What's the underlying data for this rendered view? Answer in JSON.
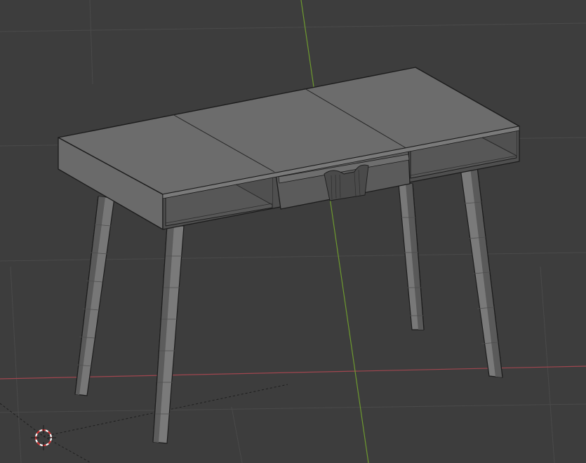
{
  "app": {
    "name": "",
    "view": ""
  },
  "viewport": {
    "background": "#3d3d3d",
    "grid_color": "#4a4a4a",
    "x_axis_color": "#a0464f",
    "y_axis_color": "#6e9a2f",
    "object_mode": "wireframe-over-solid",
    "objects": [
      {
        "name": "",
        "selected": false
      }
    ]
  },
  "icons": {
    "cursor": "3d-cursor-icon"
  }
}
